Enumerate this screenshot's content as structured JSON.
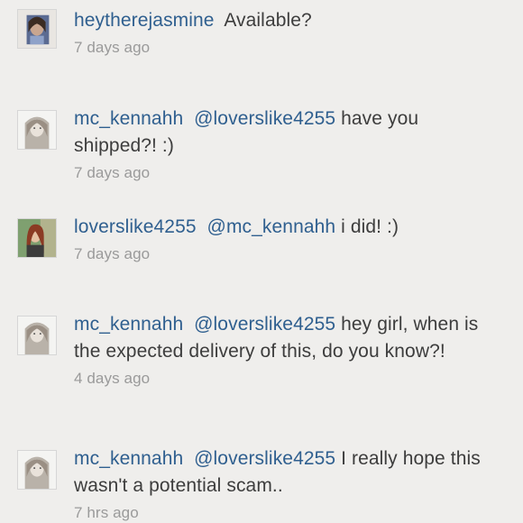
{
  "comments": [
    {
      "username": "heytherejasmine",
      "mention": "",
      "text": "Available?",
      "time": "7 days ago",
      "avatar": "avatar-jasmine"
    },
    {
      "username": "mc_kennahh",
      "mention": "@loverslike4255",
      "text": "have you shipped?! :)",
      "time": "7 days ago",
      "avatar": "avatar-kennah"
    },
    {
      "username": "loverslike4255",
      "mention": "@mc_kennahh",
      "text": "i did! :)",
      "time": "7 days ago",
      "avatar": "avatar-lovers"
    },
    {
      "username": "mc_kennahh",
      "mention": "@loverslike4255",
      "text": "hey girl, when is the expected delivery of this, do you know?!",
      "time": "4 days ago",
      "avatar": "avatar-kennah"
    },
    {
      "username": "mc_kennahh",
      "mention": "@loverslike4255",
      "text": "I really hope this wasn't a potential scam..",
      "time": "7 hrs ago",
      "avatar": "avatar-kennah"
    }
  ],
  "colors": {
    "background": "#efeeec",
    "username": "#2f5f8f",
    "text": "#3d3d3d",
    "timestamp": "#9a9a9a"
  }
}
